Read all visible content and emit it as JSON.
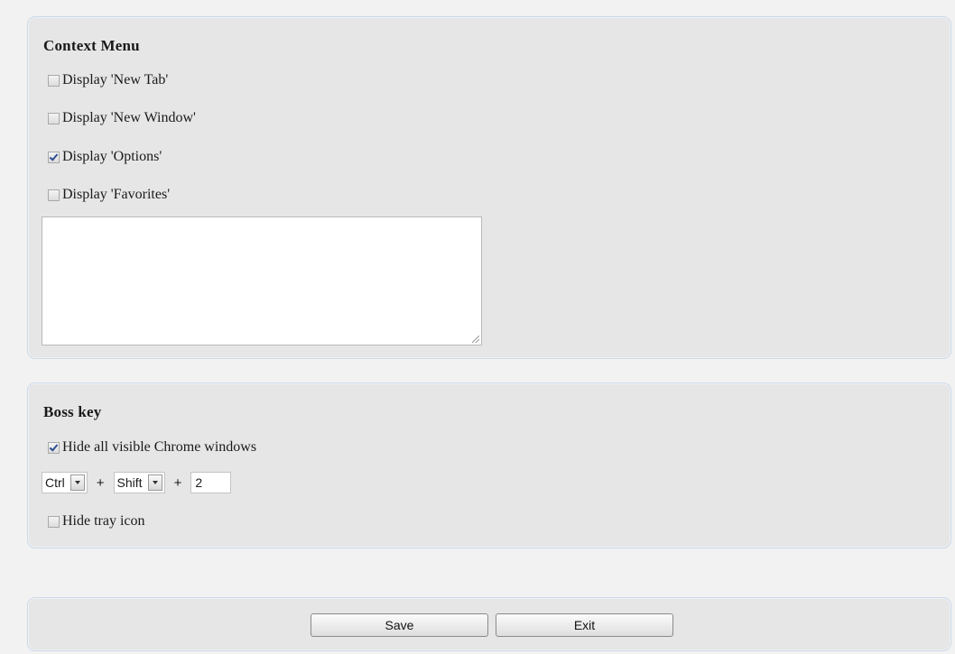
{
  "context_menu": {
    "title": "Context Menu",
    "options": [
      {
        "label": "Display 'New Tab'",
        "checked": false
      },
      {
        "label": "Display 'New Window'",
        "checked": false
      },
      {
        "label": "Display 'Options'",
        "checked": true
      },
      {
        "label": "Display 'Favorites'",
        "checked": false
      }
    ],
    "textarea_value": ""
  },
  "boss_key": {
    "title": "Boss key",
    "hide_windows": {
      "label": "Hide all visible Chrome windows",
      "checked": true
    },
    "modifier1": "Ctrl",
    "modifier2": "Shift",
    "plus_symbol": "+",
    "key": "2",
    "hide_tray": {
      "label": "Hide tray icon",
      "checked": false
    }
  },
  "footer": {
    "save_label": "Save",
    "exit_label": "Exit"
  }
}
